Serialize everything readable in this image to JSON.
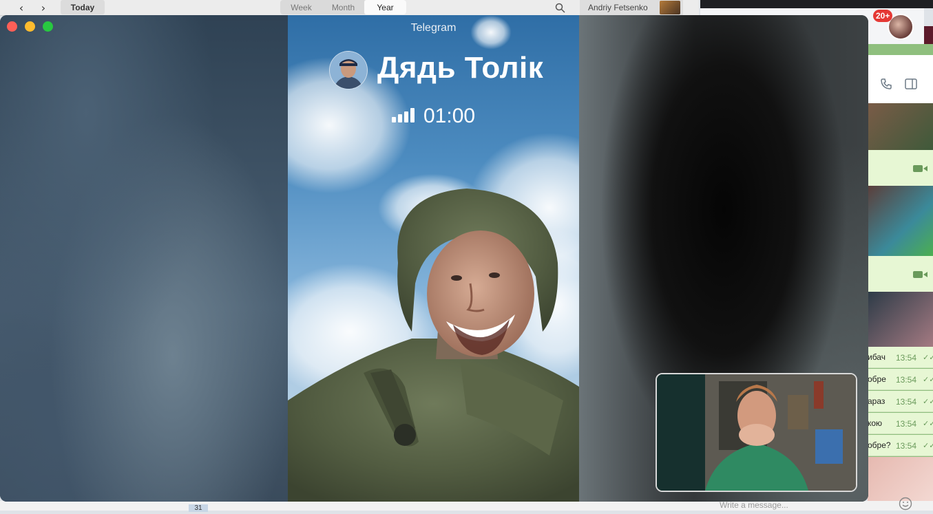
{
  "calendar": {
    "today_label": "Today",
    "views": [
      "Week",
      "Month",
      "Year"
    ],
    "active_view": "Year",
    "user_name": "Andriy Fetsenko",
    "bottom_date": "31"
  },
  "browser": {
    "notification_count": "20+"
  },
  "chat": {
    "messages": [
      {
        "text": "ибач",
        "time": "13:54",
        "status": "✓✓"
      },
      {
        "text": "обре",
        "time": "13:54",
        "status": "✓✓"
      },
      {
        "text": "араз",
        "time": "13:54",
        "status": "✓✓"
      },
      {
        "text": "кою",
        "time": "13:54",
        "status": "✓✓"
      },
      {
        "text": "обре?",
        "time": "13:54",
        "status": "✓✓"
      }
    ],
    "input_placeholder": "Write a message..."
  },
  "call": {
    "app_name": "Telegram",
    "caller_name": "Дядь Толік",
    "duration": "01:00",
    "signal_bars": 4
  },
  "colors": {
    "close": "#fe5f57",
    "minimize": "#febc2e",
    "maximize": "#28c840",
    "badge": "#e53935",
    "chat_bubble": "#e7f7d4"
  }
}
